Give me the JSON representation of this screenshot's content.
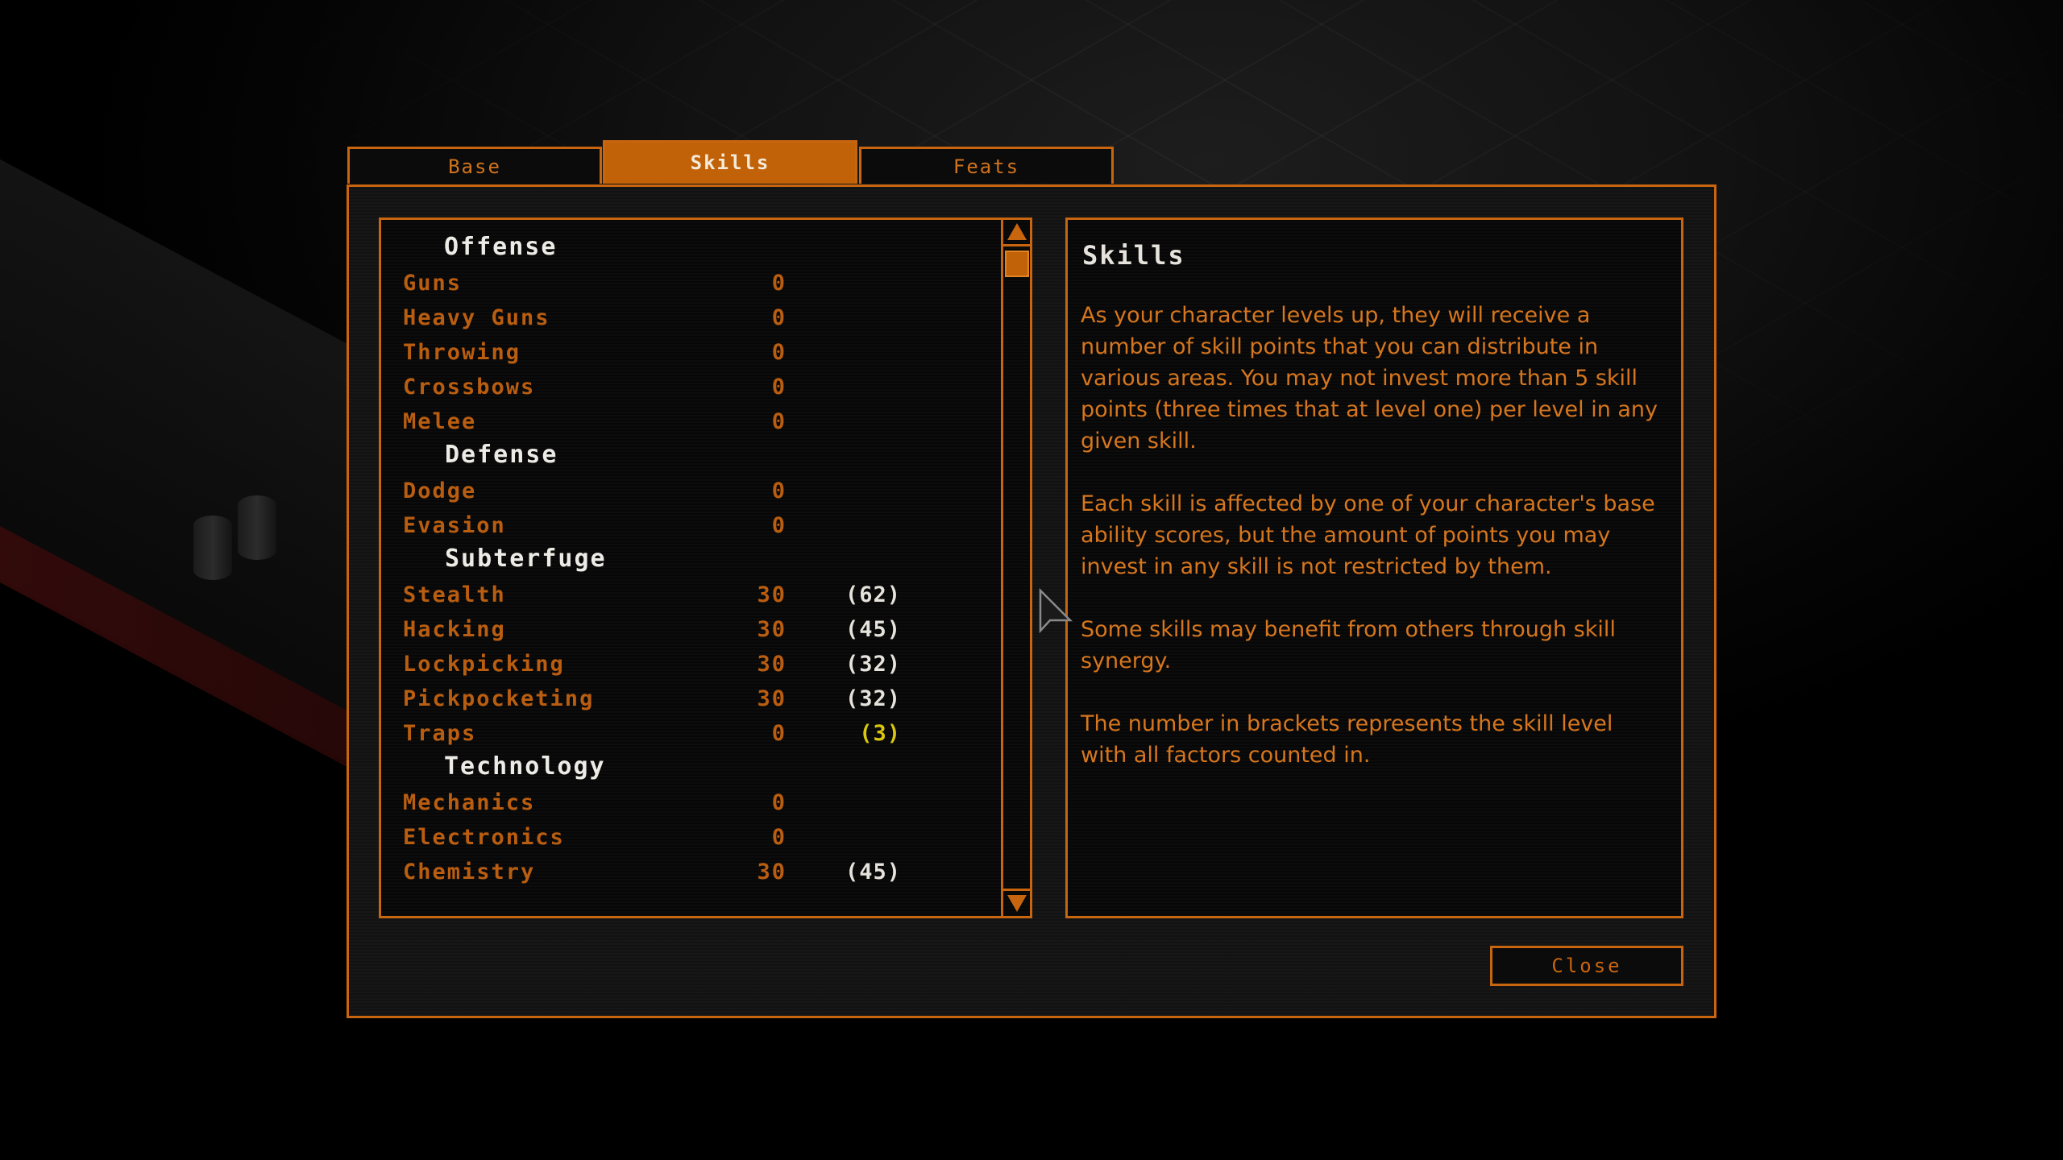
{
  "tabs": [
    {
      "label": "Base",
      "active": false
    },
    {
      "label": "Skills",
      "active": true
    },
    {
      "label": "Feats",
      "active": false
    }
  ],
  "skill_list": {
    "categories": {
      "offense": "Offense",
      "defense": "Defense",
      "subterfuge": "Subterfuge",
      "technology": "Technology"
    },
    "skills": [
      {
        "name": "Guns",
        "value": "0",
        "total": ""
      },
      {
        "name": "Heavy Guns",
        "value": "0",
        "total": ""
      },
      {
        "name": "Throwing",
        "value": "0",
        "total": ""
      },
      {
        "name": "Crossbows",
        "value": "0",
        "total": ""
      },
      {
        "name": "Melee",
        "value": "0",
        "total": ""
      },
      {
        "name": "Dodge",
        "value": "0",
        "total": ""
      },
      {
        "name": "Evasion",
        "value": "0",
        "total": ""
      },
      {
        "name": "Stealth",
        "value": "30",
        "total": "(62)"
      },
      {
        "name": "Hacking",
        "value": "30",
        "total": "(45)"
      },
      {
        "name": "Lockpicking",
        "value": "30",
        "total": "(32)"
      },
      {
        "name": "Pickpocketing",
        "value": "30",
        "total": "(32)"
      },
      {
        "name": "Traps",
        "value": "0",
        "total": "(3)"
      },
      {
        "name": "Mechanics",
        "value": "0",
        "total": ""
      },
      {
        "name": "Electronics",
        "value": "0",
        "total": ""
      },
      {
        "name": "Chemistry",
        "value": "30",
        "total": "(45)"
      }
    ]
  },
  "description": {
    "title": "Skills",
    "paragraphs": [
      "As your character levels up, they will receive a number of skill points that you can distribute in various areas. You may not invest more than 5 skill points (three times that at level one) per level in any given skill.",
      "Each skill is affected by one of your character's base ability scores, but the amount of points you may invest in any skill is not restricted by them.",
      "Some skills may benefit from others through skill synergy.",
      "The number in brackets represents the skill level with all factors counted in."
    ]
  },
  "close_label": "Close",
  "colors": {
    "accent": "#c8650f",
    "skill_text": "#b95d10",
    "heading_text": "#ecebe6",
    "highlight_total": "#d9c60f"
  }
}
